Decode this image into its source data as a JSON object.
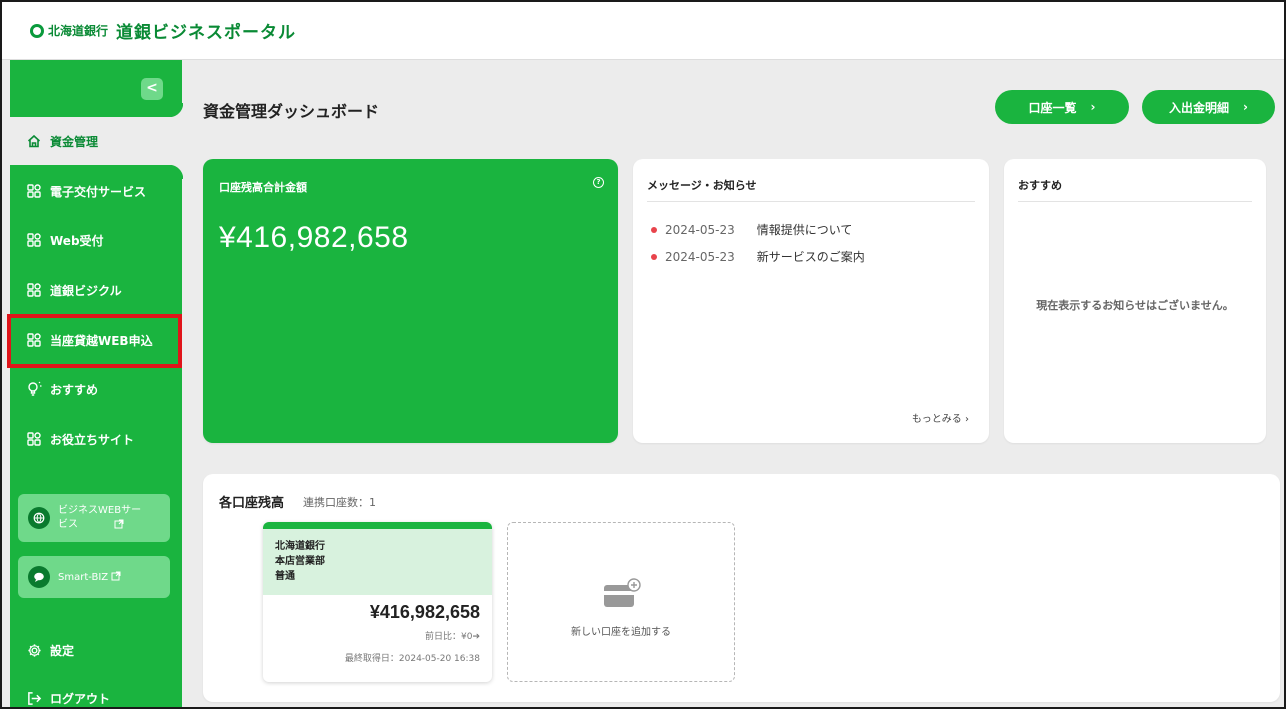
{
  "header": {
    "bank_name": "北海道銀行",
    "portal_name": "道銀ビジネスポータル"
  },
  "sidebar": {
    "collapse_label": "<",
    "items": [
      {
        "label": "資金管理",
        "icon": "home-icon",
        "active": true
      },
      {
        "label": "電子交付サービス",
        "icon": "grid-icon"
      },
      {
        "label": "Web受付",
        "icon": "grid-icon"
      },
      {
        "label": "道銀ビジクル",
        "icon": "grid-icon"
      },
      {
        "label": "当座貸越WEB申込",
        "icon": "grid-icon",
        "highlighted": true
      },
      {
        "label": "おすすめ",
        "icon": "lightbulb-icon"
      },
      {
        "label": "お役立ちサイト",
        "icon": "grid-icon"
      }
    ],
    "external": [
      {
        "label": "ビジネスWEBサービス",
        "icon": "globe-icon"
      },
      {
        "label": "Smart-BIZ",
        "icon": "chat-icon"
      }
    ],
    "settings_label": "設定",
    "logout_label": "ログアウト"
  },
  "main": {
    "title": "資金管理ダッシュボード",
    "buttons": {
      "accounts": "口座一覧",
      "statement": "入出金明細"
    },
    "balance_card": {
      "title": "口座残高合計金額",
      "amount": "¥416,982,658"
    },
    "messages": {
      "title": "メッセージ・お知らせ",
      "items": [
        {
          "date": "2024-05-23",
          "title": "情報提供について"
        },
        {
          "date": "2024-05-23",
          "title": "新サービスのご案内"
        }
      ],
      "more": "もっとみる ›"
    },
    "recommend": {
      "title": "おすすめ",
      "empty": "現在表示するお知らせはございません。"
    },
    "accounts": {
      "title": "各口座残高",
      "count_label": "連携口座数：1",
      "card": {
        "bank": "北海道銀行",
        "branch": "本店営業部",
        "type": "普通",
        "balance": "¥416,982,658",
        "diff": "前日比：¥0➔",
        "updated": "最終取得日：2024-05-20 16:38"
      },
      "add_label": "新しい口座を追加する"
    }
  },
  "colors": {
    "brand_green": "#1ab43f",
    "brand_dark": "#0a8a35",
    "highlight_red": "#e0141a",
    "dot_red": "#e8434b"
  }
}
